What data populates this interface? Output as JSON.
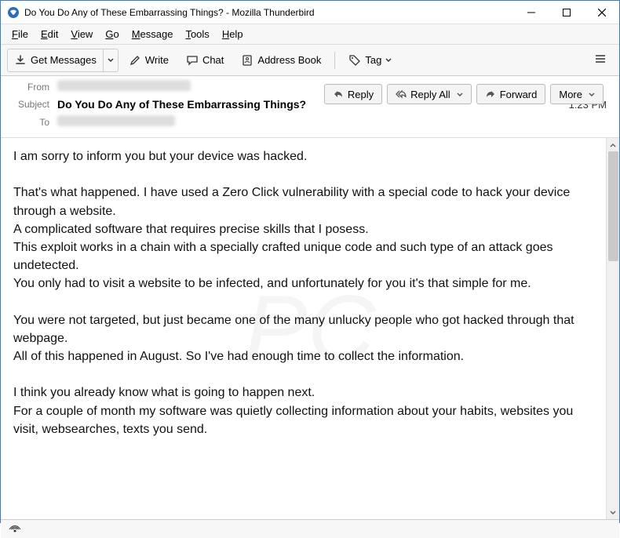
{
  "window": {
    "title": "Do You Do Any of These Embarrassing Things? - Mozilla Thunderbird"
  },
  "menu": {
    "file": "File",
    "edit": "Edit",
    "view": "View",
    "go": "Go",
    "message": "Message",
    "tools": "Tools",
    "help": "Help"
  },
  "toolbar": {
    "get_messages": "Get Messages",
    "write": "Write",
    "chat": "Chat",
    "address_book": "Address Book",
    "tag": "Tag"
  },
  "actions": {
    "reply": "Reply",
    "reply_all": "Reply All",
    "forward": "Forward",
    "more": "More"
  },
  "headers": {
    "from_label": "From",
    "subject_label": "Subject",
    "to_label": "To",
    "subject_value": "Do You Do Any of These Embarrassing Things?",
    "time": "1:23 PM"
  },
  "body": {
    "p1": "I am sorry to inform you but your device was hacked.",
    "p2": "",
    "p3": "That's what happened. I have used a Zero Click vulnerability with a special code to hack your device through a website.",
    "p4": "A complicated software that requires precise skills that I posess.",
    "p5": "This exploit works in a chain with a specially crafted unique code and such type of an attack goes undetected.",
    "p6": "You only had to visit a website to be infected, and unfortunately for you it's that simple for me.",
    "p7": "",
    "p8": "You were not targeted, but just became one of the many unlucky people who got hacked through that webpage.",
    "p9": "All of this happened in August. So I've had enough time to collect the information.",
    "p10": "",
    "p11": "I think you already know what is going to happen next.",
    "p12": "For a couple of month my software was quietly collecting information about your habits, websites you visit, websearches, texts you send."
  }
}
